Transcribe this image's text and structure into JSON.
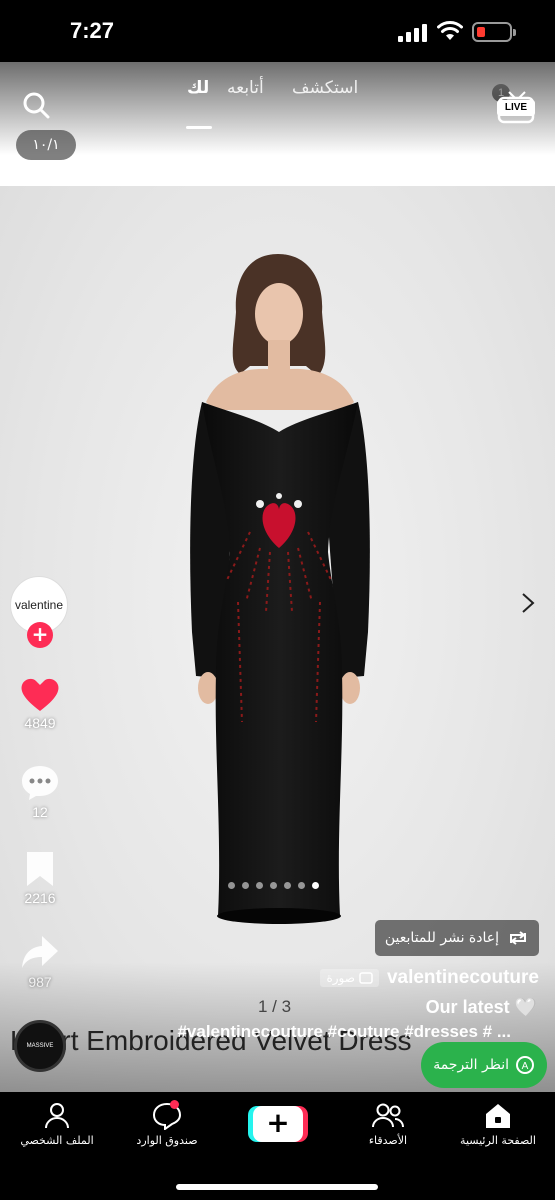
{
  "status_bar": {
    "time": "7:27"
  },
  "website": {
    "brand": "valentine",
    "cart_count": "1"
  },
  "top_tabs": {
    "explore": "استكشف",
    "following": "أتابعه",
    "for_you": "لك",
    "live": "LIVE"
  },
  "photo_counter": "١٠/١",
  "rail": {
    "avatar_text": "valentine",
    "likes": "4849",
    "comments": "12",
    "saves": "2216",
    "shares": "987"
  },
  "carousel": {
    "total_dots": 7,
    "active_dot": 7
  },
  "repost_label": "إعادة نشر للمتابعين",
  "post": {
    "author": "valentinecouture",
    "type_badge": "صورة",
    "page_indicator": "1 / 3",
    "caption_line1": "Our latest 🤍",
    "caption_line2": "#valentinecouture #couture #dresses # ...",
    "product_title": "Heart Embroidered Velvet Dress",
    "music_label": "MASSIVE ATTACK"
  },
  "translate_label": "انظر الترجمة",
  "bottom_nav": {
    "home": "الصفحة الرئيسية",
    "friends": "الأصدقاء",
    "create": "+",
    "inbox": "صندوق الوارد",
    "profile": "الملف الشخصي"
  },
  "colors": {
    "accent": "#fe2c55",
    "cyan": "#25f4ee",
    "translate": "#2bb24c"
  }
}
